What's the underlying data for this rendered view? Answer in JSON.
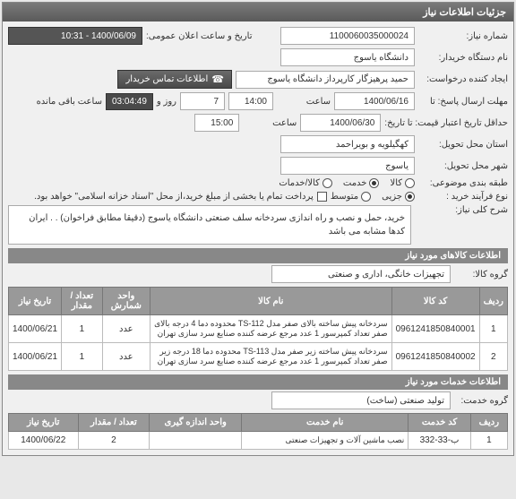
{
  "panel_title": "جزئیات اطلاعات نیاز",
  "fields": {
    "need_no_label": "شماره نیاز:",
    "need_no": "1100060035000024",
    "announce_label": "تاریخ و ساعت اعلان عمومی:",
    "announce_value": "1400/06/09 - 10:31",
    "buyer_name_label": "نام دستگاه خریدار:",
    "buyer_name": "دانشگاه یاسوج",
    "creator_label": "ایجاد کننده درخواست:",
    "creator": "حمید پرهیزگار کارپرداز دانشگاه یاسوج",
    "contact_btn": "اطلاعات تماس خریدار",
    "deadline_label": "مهلت ارسال پاسخ: تا",
    "deadline_date": "1400/06/16",
    "time_label": "ساعت",
    "deadline_time": "14:00",
    "days": "7",
    "days_and": "روز و",
    "timer": "03:04:49",
    "remaining": "ساعت باقی مانده",
    "validity_label": "حداقل تاریخ اعتبار قیمت: تا تاریخ:",
    "validity_date": "1400/06/30",
    "validity_time": "15:00",
    "province_label": "استان محل تحویل:",
    "province": "کهگیلویه و بویراحمد",
    "city_label": "شهر محل تحویل:",
    "city": "یاسوج",
    "budget_label": "طبقه بندی موضوعی:",
    "type_label": "نوع فرآیند خرید :",
    "r_goods": "کالا",
    "r_service": "خدمت",
    "r_both": "کالا/خدمات",
    "r_minor": "جزیی",
    "r_medium": "متوسط",
    "pay_note": "پرداخت تمام یا بخشی از مبلغ خرید،از محل \"اسناد خزانه اسلامی\" خواهد بود.",
    "desc_label": "شرح کلی نیاز:",
    "desc": "خرید، حمل و نصب و راه اندازی سردخانه سلف صنعتی دانشگاه یاسوج (دقیقا مطابق فراخوان) . . ایران کدها مشابه می باشد"
  },
  "goods_header": "اطلاعات کالاهای مورد نیاز",
  "goods_group_label": "گروه کالا:",
  "goods_group": "تجهیزات خانگی، اداری و صنعتی",
  "goods_cols": {
    "row": "ردیف",
    "code": "کد کالا",
    "name": "نام کالا",
    "unit": "واحد شمارش",
    "qty": "تعداد / مقدار",
    "date": "تاریخ نیاز"
  },
  "goods_rows": [
    {
      "row": "1",
      "code": "0961241850840001",
      "name": "سردخانه پیش ساخته بالای صفر مدل TS-112 محدوده دما 4 درجه بالای صفر تعداد کمپرسور 1 عدد مرجع عرضه کننده صنایع سرد سازی تهران",
      "unit": "عدد",
      "qty": "1",
      "date": "1400/06/21"
    },
    {
      "row": "2",
      "code": "0961241850840002",
      "name": "سردخانه پیش ساخته زیر صفر مدل TS-113 محدوده دما 18 درجه زیر صفر تعداد کمپرسور 1 عدد مرجع عرضه کننده صنایع سرد سازی تهران",
      "unit": "عدد",
      "qty": "1",
      "date": "1400/06/21"
    }
  ],
  "svc_header": "اطلاعات خدمات مورد نیاز",
  "svc_group_label": "گروه خدمت:",
  "svc_group": "تولید صنعتی (ساخت)",
  "svc_cols": {
    "row": "ردیف",
    "code": "کد خدمت",
    "name": "نام خدمت",
    "unit": "واحد اندازه گیری",
    "qty": "تعداد / مقدار",
    "date": "تاریخ نیاز"
  },
  "svc_rows": [
    {
      "row": "1",
      "code": "ب-33-332",
      "name": "نصب ماشین آلات و تجهیزات صنعتی",
      "unit": "",
      "qty": "2",
      "date": "1400/06/22"
    }
  ]
}
